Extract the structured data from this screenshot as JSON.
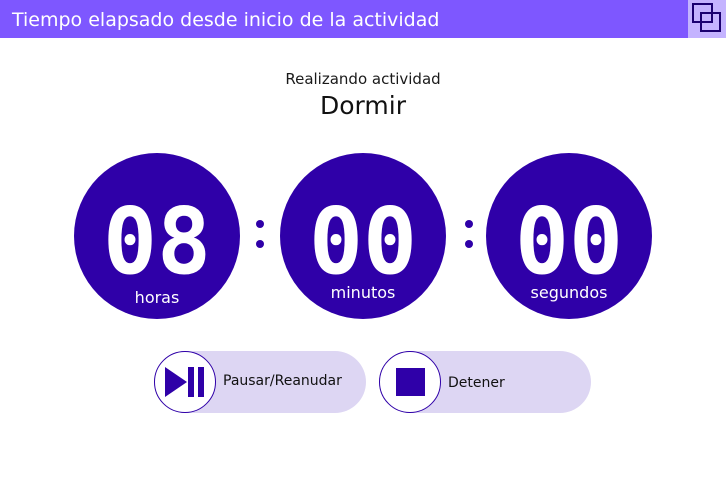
{
  "window": {
    "title": "Tiempo elapsado desde inicio de la actividad",
    "restore_icon": "restore-window-icon"
  },
  "activity": {
    "caption": "Realizando actividad",
    "name": "Dormir"
  },
  "timer": {
    "hours": "08",
    "minutes": "00",
    "seconds": "00",
    "hours_label": "horas",
    "minutes_label": "minutos",
    "seconds_label": "segundos",
    "separator_icon": "colon-separator"
  },
  "controls": {
    "pause_label": "Pausar/Reanudar",
    "pause_icon": "play-pause-icon",
    "stop_label": "Detener",
    "stop_icon": "stop-icon"
  },
  "colors": {
    "titlebar": "#7e57ff",
    "restore_button": "#c4b3ff",
    "circle": "#2f00a8",
    "pill": "#ddd6f3"
  }
}
